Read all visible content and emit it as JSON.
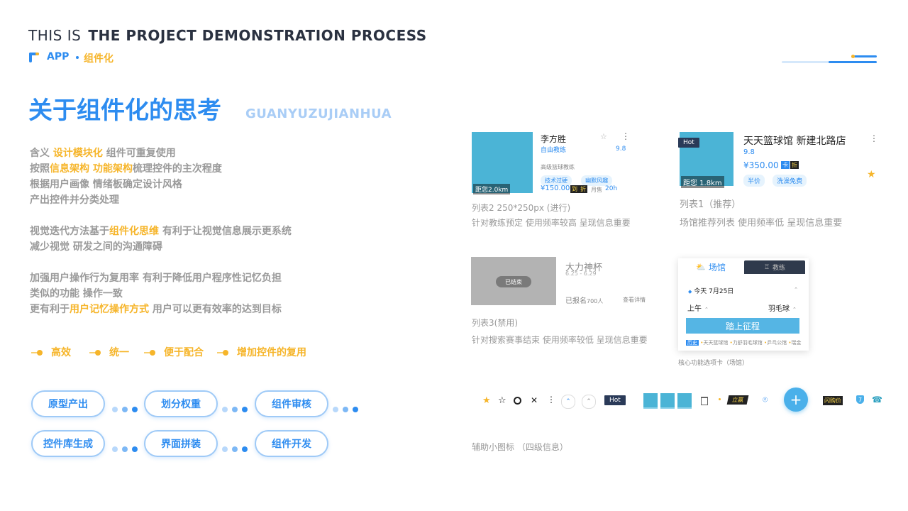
{
  "header": {
    "this_is": "THIS IS",
    "project": "THE PROJECT DEMONSTRATION PROCESS",
    "app": "APP",
    "section": "组件化"
  },
  "title": {
    "cn": "关于组件化的思考",
    "en": "GUANYUZUJIANHUA"
  },
  "paragraphs": {
    "p1": {
      "l1_a": "含义 ",
      "l1_hl": "设计模块化",
      "l1_b": " 组件可重复使用",
      "l2_a": "按照",
      "l2_hl1": "信息架构",
      "l2_mid": " ",
      "l2_hl2": "功能架构",
      "l2_b": "梳理控件的主次程度",
      "l3": "根据用户画像 情绪板确定设计风格",
      "l4": "产出控件并分类处理"
    },
    "p2": {
      "l1_a": "视觉迭代方法基于",
      "l1_hl": "组件化思维",
      "l1_b": " 有利于让视觉信息展示更系统",
      "l2": "减少视觉 研发之间的沟通障碍"
    },
    "p3": {
      "l1": "加强用户操作行为复用率 有利于降低用户程序性记忆负担",
      "l2": "类似的功能 操作一致",
      "l3_a": "更有利于",
      "l3_hl": "用户记忆操作方式",
      "l3_b": " 用户可以更有效率的达到目标"
    }
  },
  "benefits": [
    "高效",
    "统一",
    "便于配合",
    "增加控件的复用"
  ],
  "process": [
    "原型产出",
    "划分权重",
    "组件审核",
    "控件库生成",
    "界面拼装",
    "组件开发"
  ],
  "card2": {
    "name": "李方胜",
    "role": "自由教练",
    "rating": "9.8",
    "desc": "高级篮球教练",
    "tags": [
      "技术过硬",
      "幽默风趣"
    ],
    "distance": "距您2.0km",
    "price": "¥150.00",
    "pay_badge": "到",
    "pay_badge2": "折",
    "month_label": "月售",
    "month_value": "20h",
    "caption_title": "列表2   250*250px (进行)",
    "caption_desc": "针对教练预定   使用频率较高   呈现信息重要"
  },
  "card1": {
    "hot": "Hot",
    "name": "天天篮球馆   新建北路店",
    "rating": "9.8",
    "price": "¥350.00",
    "pay_badge": "卡",
    "pay_badge2": "折",
    "tags": [
      "半价",
      "洗澡免费"
    ],
    "distance": "距您 1.8km",
    "caption_title": "列表1（推荐）",
    "caption_desc": "场馆推荐列表   使用频率低   呈现信息重要"
  },
  "card3": {
    "status": "已结束",
    "name": "大力神杯",
    "dates": "6.25 - 6.29",
    "signup_label": "已报名",
    "signup_count": "700人",
    "detail_link": "查看详情",
    "caption_title": "列表3(禁用)",
    "caption_desc": "针对搜索赛事结束   使用频率较低   呈现信息重要"
  },
  "tab_card": {
    "tab_active": "场馆",
    "tab_inactive": "教练",
    "date": "今天  7月25日",
    "time": "上午",
    "sport": "羽毛球",
    "go_button": "踏上征程",
    "recent_label": "历史",
    "recent_items": [
      "天天篮球馆",
      "力舒羽毛球馆",
      "乒乓公馆",
      "瑞金"
    ],
    "caption": "核心功能选项卡（场馆）"
  },
  "icons_row": {
    "hot": "Hot",
    "flash_label": "立赢",
    "flash_price": "闪购价",
    "badge_num": "7",
    "caption": "辅助小图标  （四级信息）"
  },
  "colors": {
    "primary": "#2d8cf0",
    "accent": "#f6b52a",
    "thumb": "#4bb4d6",
    "dark": "#2a3140"
  }
}
